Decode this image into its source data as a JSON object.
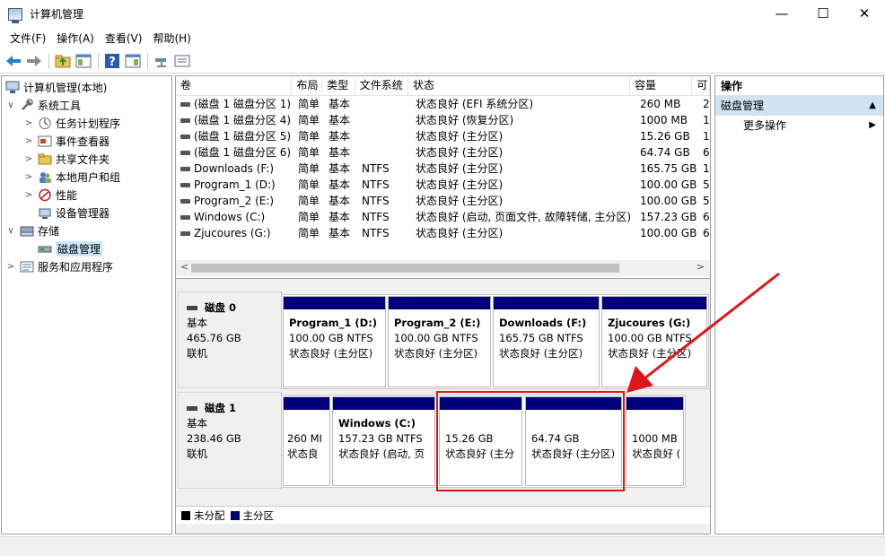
{
  "window": {
    "title": "计算机管理"
  },
  "menu": [
    "文件(F)",
    "操作(A)",
    "查看(V)",
    "帮助(H)"
  ],
  "tree": [
    {
      "label": "计算机管理(本地)",
      "icon": "computer-icon",
      "level": 0,
      "expand": ""
    },
    {
      "label": "系统工具",
      "icon": "tools-icon",
      "level": 1,
      "expand": "∨"
    },
    {
      "label": "任务计划程序",
      "icon": "clock-icon",
      "level": 2,
      "expand": ">"
    },
    {
      "label": "事件查看器",
      "icon": "event-viewer-icon",
      "level": 2,
      "expand": ">"
    },
    {
      "label": "共享文件夹",
      "icon": "shared-folder-icon",
      "level": 2,
      "expand": ">"
    },
    {
      "label": "本地用户和组",
      "icon": "users-icon",
      "level": 2,
      "expand": ">"
    },
    {
      "label": "性能",
      "icon": "performance-icon",
      "level": 2,
      "expand": ">"
    },
    {
      "label": "设备管理器",
      "icon": "device-manager-icon",
      "level": 2,
      "expand": ""
    },
    {
      "label": "存储",
      "icon": "storage-icon",
      "level": 1,
      "expand": "∨"
    },
    {
      "label": "磁盘管理",
      "icon": "disk-management-icon",
      "level": 2,
      "expand": "",
      "selected": true
    },
    {
      "label": "服务和应用程序",
      "icon": "services-icon",
      "level": 1,
      "expand": ">"
    }
  ],
  "volume_table": {
    "headers": [
      "卷",
      "布局",
      "类型",
      "文件系统",
      "状态",
      "容量",
      "可"
    ],
    "rows": [
      [
        "(磁盘 1 磁盘分区 1)",
        "简单",
        "基本",
        "",
        "状态良好 (EFI 系统分区)",
        "260 MB",
        "2"
      ],
      [
        "(磁盘 1 磁盘分区 4)",
        "简单",
        "基本",
        "",
        "状态良好 (恢复分区)",
        "1000 MB",
        "1"
      ],
      [
        "(磁盘 1 磁盘分区 5)",
        "简单",
        "基本",
        "",
        "状态良好 (主分区)",
        "15.26 GB",
        "1"
      ],
      [
        "(磁盘 1 磁盘分区 6)",
        "简单",
        "基本",
        "",
        "状态良好 (主分区)",
        "64.74 GB",
        "6"
      ],
      [
        "Downloads (F:)",
        "简单",
        "基本",
        "NTFS",
        "状态良好 (主分区)",
        "165.75 GB",
        "1"
      ],
      [
        "Program_1 (D:)",
        "简单",
        "基本",
        "NTFS",
        "状态良好 (主分区)",
        "100.00 GB",
        "5"
      ],
      [
        "Program_2 (E:)",
        "简单",
        "基本",
        "NTFS",
        "状态良好 (主分区)",
        "100.00 GB",
        "5"
      ],
      [
        "Windows (C:)",
        "简单",
        "基本",
        "NTFS",
        "状态良好 (启动, 页面文件, 故障转储, 主分区)",
        "157.23 GB",
        "6"
      ],
      [
        "Zjucoures (G:)",
        "简单",
        "基本",
        "NTFS",
        "状态良好 (主分区)",
        "100.00 GB",
        "6"
      ]
    ]
  },
  "disks": [
    {
      "name": "磁盘 0",
      "type": "基本",
      "size": "465.76 GB",
      "status": "联机",
      "partitions": [
        {
          "name": "Program_1  (D:)",
          "size": "100.00 GB NTFS",
          "status": "状态良好 (主分区)"
        },
        {
          "name": "Program_2  (E:)",
          "size": "100.00 GB NTFS",
          "status": "状态良好 (主分区)"
        },
        {
          "name": "Downloads  (F:)",
          "size": "165.75 GB NTFS",
          "status": "状态良好 (主分区)"
        },
        {
          "name": "Zjucoures  (G:)",
          "size": "100.00 GB NTFS",
          "status": "状态良好 (主分区)"
        }
      ]
    },
    {
      "name": "磁盘 1",
      "type": "基本",
      "size": "238.46 GB",
      "status": "联机",
      "partitions": [
        {
          "name": "",
          "size": "260 MI",
          "status": "状态良"
        },
        {
          "name": "Windows  (C:)",
          "size": "157.23 GB NTFS",
          "status": "状态良好 (启动, 页"
        },
        {
          "name": "",
          "size": "15.26 GB",
          "status": "状态良好 (主分"
        },
        {
          "name": "",
          "size": "64.74 GB",
          "status": "状态良好 (主分区)"
        },
        {
          "name": "",
          "size": "1000 MB",
          "status": "状态良好 ("
        }
      ]
    }
  ],
  "legend": [
    {
      "label": "未分配",
      "color": "#000000"
    },
    {
      "label": "主分区",
      "color": "#00007a"
    }
  ],
  "actions": {
    "header": "操作",
    "section": "磁盘管理",
    "items": [
      "更多操作"
    ]
  },
  "colors": {
    "primary_partition": "#00007a",
    "annotation": "#e1141c"
  }
}
